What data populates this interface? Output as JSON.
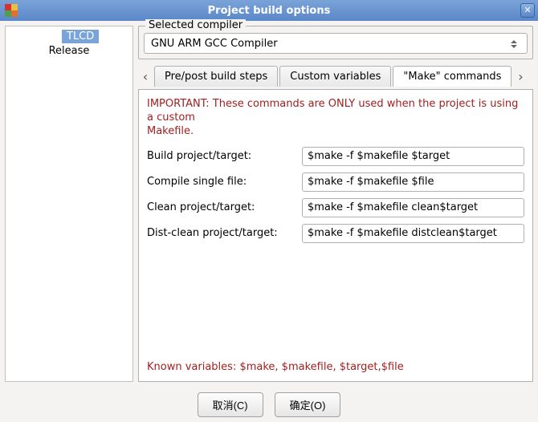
{
  "window": {
    "title": "Project build options"
  },
  "sidebar": {
    "items": [
      {
        "label": "TLCD",
        "selected": true
      },
      {
        "label": "Release",
        "selected": false
      }
    ]
  },
  "compiler": {
    "legend": "Selected compiler",
    "value": "GNU ARM GCC Compiler"
  },
  "tabs": {
    "items": [
      {
        "label": "Pre/post build steps"
      },
      {
        "label": "Custom variables"
      },
      {
        "label": "\"Make\" commands"
      }
    ],
    "active": 2
  },
  "make": {
    "warning": "IMPORTANT: These commands are ONLY used when the project is using a custom\nMakefile.",
    "rows": [
      {
        "label": "Build project/target:",
        "value": "$make -f $makefile $target"
      },
      {
        "label": "Compile single file:",
        "value": "$make -f $makefile $file"
      },
      {
        "label": "Clean project/target:",
        "value": "$make -f $makefile clean$target"
      },
      {
        "label": "Dist-clean project/target:",
        "value": "$make -f $makefile distclean$target"
      }
    ],
    "known": "Known variables: $make, $makefile, $target,$file"
  },
  "buttons": {
    "cancel": "取消(C)",
    "ok": "确定(O)"
  }
}
